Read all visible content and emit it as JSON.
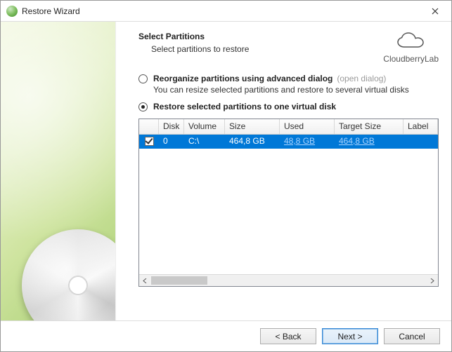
{
  "window": {
    "title": "Restore Wizard"
  },
  "brand": {
    "name": "CloudberryLab"
  },
  "header": {
    "title": "Select Partitions",
    "subtitle": "Select partitions to restore"
  },
  "options": {
    "reorganize": {
      "label": "Reorganize partitions using advanced dialog",
      "hint": "(open dialog)",
      "description": "You can resize selected partitions and restore to several virtual disks",
      "selected": false
    },
    "restore_one": {
      "label": "Restore selected partitions to one virtual disk",
      "selected": true
    }
  },
  "table": {
    "columns": {
      "disk": "Disk",
      "volume": "Volume",
      "size": "Size",
      "used": "Used",
      "target": "Target Size",
      "label": "Label"
    },
    "rows": [
      {
        "checked": true,
        "disk": "0",
        "volume": "C:\\",
        "size": "464,8 GB",
        "used": "48,8 GB",
        "target": "464,8 GB",
        "label": ""
      }
    ]
  },
  "buttons": {
    "back": "< Back",
    "next": "Next >",
    "cancel": "Cancel"
  }
}
